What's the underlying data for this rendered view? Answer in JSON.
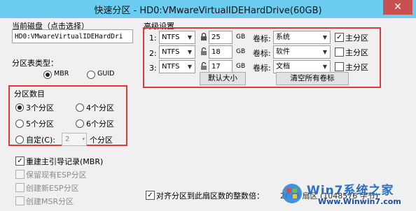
{
  "window": {
    "title": "快速分区 - HD0:VMwareVirtualIDEHardDrive(60GB)",
    "close_glyph": "✕"
  },
  "disk": {
    "label": "当前磁盘（点击选择）",
    "value": "HD0:VMwareVirtualIDEHardDri"
  },
  "table_type": {
    "label": "分区表类型：",
    "options": [
      "MBR",
      "GUID"
    ],
    "selected": "MBR"
  },
  "partition_count": {
    "label": "分区数目",
    "options": [
      "3个分区",
      "4个分区",
      "5个分区",
      "6个分区"
    ],
    "selected": "3个分区",
    "custom_label": "自定(C):",
    "custom_value": "2",
    "custom_suffix": "个分区"
  },
  "options": {
    "rebuild_mbr": {
      "label": "重建主引导记录(MBR)",
      "checked": true
    },
    "keep_esp": "保留现有ESP分区",
    "create_esp": "创建新ESP分区",
    "create_msr": "创建MSR分区"
  },
  "advanced": {
    "label": "高级设置",
    "rows": [
      {
        "num": "1:",
        "fs": "NTFS",
        "size": "25",
        "unit": "GB",
        "vol_label": "卷标:",
        "vol": "系统",
        "primary_label": "主分区",
        "primary": true
      },
      {
        "num": "2:",
        "fs": "NTFS",
        "size": "18",
        "unit": "GB",
        "vol_label": "卷标:",
        "vol": "软件",
        "primary_label": "主分区",
        "primary": false
      },
      {
        "num": "3:",
        "fs": "NTFS",
        "size": "17",
        "unit": "GB",
        "vol_label": "卷标:",
        "vol": "文档",
        "primary_label": "主分区",
        "primary": false
      }
    ],
    "default_size_button": "默认大小",
    "clear_labels_button": "清空所有卷标"
  },
  "align": {
    "label": "对齐分区到此扇区数的整数倍：",
    "value": "2048 扇区 (1048576 字节)",
    "checked": true
  },
  "watermark": {
    "brand": "Win7系统之家",
    "url": "Www.Winwin7.com"
  },
  "colors": {
    "titlebar": "#6ccdf0",
    "close": "#c75050",
    "highlight_box": "#e0393c"
  }
}
